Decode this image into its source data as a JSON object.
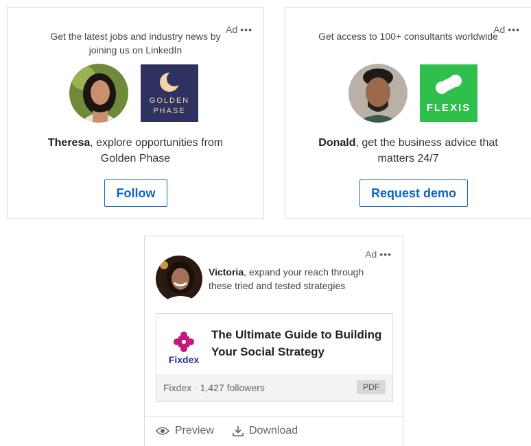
{
  "cards": [
    {
      "ad_label": "Ad",
      "more_label": "•••",
      "intro_line1": "Get the latest jobs and industry news by",
      "intro_line2": "joining us on LinkedIn",
      "user_name": "Theresa",
      "message_rest": ", explore opportunities from",
      "message_line2": "Golden Phase",
      "logo_text_line1": "GOLDEN",
      "logo_text_line2": "PHASE",
      "cta_label": "Follow"
    },
    {
      "ad_label": "Ad",
      "more_label": "•••",
      "intro_line1": "Get access to 100+ consultants worldwide",
      "user_name": "Donald",
      "message_rest": ", get the business advice that",
      "message_line2": "matters 24/7",
      "logo_text": "FLEXIS",
      "cta_label": "Request demo"
    },
    {
      "ad_label": "Ad",
      "more_label": "•••",
      "user_name": "Victoria",
      "message_rest": ", expand your reach through",
      "message_line2": "these tried and tested strategies",
      "company_logo_text": "Fixdex",
      "document_title_line1": "The Ultimate Guide to Building",
      "document_title_line2": "Your Social Strategy",
      "company_meta": "Fixdex · 1,427 followers",
      "doc_badge": "PDF",
      "preview_label": "Preview",
      "download_label": "Download"
    }
  ],
  "colors": {
    "link_blue": "#0a66c2",
    "golden_phase_bg": "#2f3260",
    "golden_phase_gold": "#f2d7a6",
    "flexis_green": "#2fbf4b",
    "fixdex_magenta": "#c2187a",
    "fixdex_navy": "#27358c"
  }
}
